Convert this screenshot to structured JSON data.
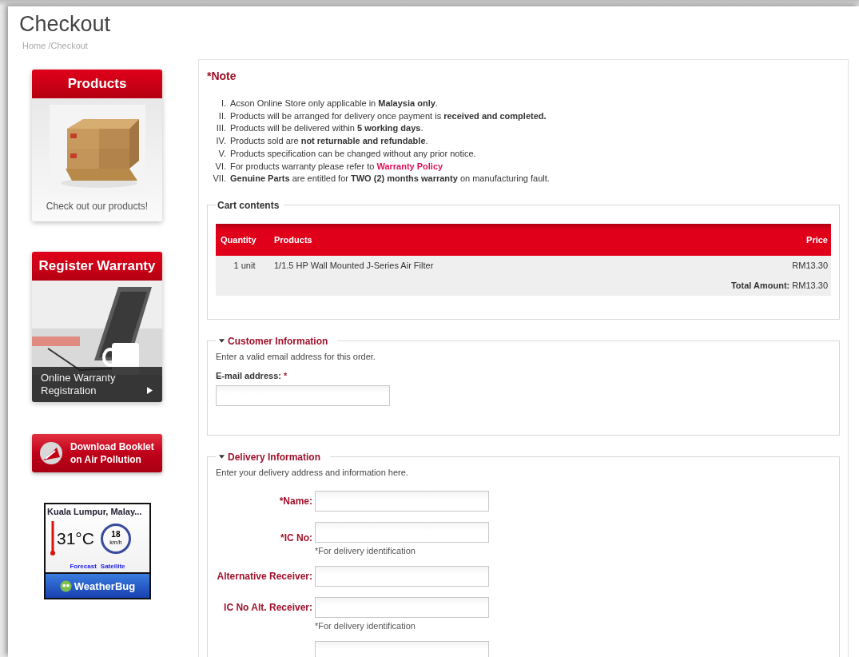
{
  "page": {
    "title": "Checkout",
    "breadcrumb": "Home /Checkout"
  },
  "sidebar": {
    "products_card": {
      "title": "Products",
      "caption": "Check out our products!"
    },
    "warranty_card": {
      "title": "Register Warranty",
      "caption_line1": "Online Warranty",
      "caption_line2": "Registration"
    },
    "booklet_button": {
      "line1": "Download Booklet",
      "line2": "on Air Pollution"
    },
    "weather": {
      "location": "Kuala Lumpur, Malay...",
      "temperature": "31°C",
      "wind_speed": "18",
      "wind_unit": "km/h",
      "links": [
        "Forecast",
        "Satellite"
      ],
      "brand": "WeatherBug"
    }
  },
  "note": {
    "title": "*Note",
    "items": [
      {
        "numeral": "I.",
        "text": "Acson Online Store only applicable in **Malaysia only**."
      },
      {
        "numeral": "II.",
        "text": "Products will be arranged for delivery once payment is **received and completed.**"
      },
      {
        "numeral": "III.",
        "text": "Products will be delivered within **5 working days**."
      },
      {
        "numeral": "IV.",
        "text": "Products sold are **not returnable and refundable**."
      },
      {
        "numeral": "V.",
        "text": "Products specification can be changed without any prior notice."
      },
      {
        "numeral": "VI.",
        "text": "For products warranty please refer to ",
        "link": "Warranty Policy"
      },
      {
        "numeral": "VII.",
        "text": "**Genuine Parts** are entitled for **TWO (2) months warranty** on manufacturing fault."
      }
    ]
  },
  "cart": {
    "legend": "Cart contents",
    "columns": [
      "Quantity",
      "Products",
      "Price"
    ],
    "rows": [
      {
        "quantity": "1 unit",
        "product": "1/1.5 HP Wall Mounted J-Series Air Filter",
        "price": "RM13.30"
      }
    ],
    "total_label": "Total Amount:",
    "total_value": "RM13.30"
  },
  "customer": {
    "legend": "Customer Information",
    "expanded": true,
    "intro": "Enter a valid email address for this order.",
    "email_label": "E-mail address:",
    "required_mark": "*"
  },
  "delivery": {
    "legend": "Delivery Information",
    "expanded": true,
    "intro": "Enter your delivery address and information here.",
    "fields": [
      {
        "label": "*Name:"
      },
      {
        "label": "*IC No:",
        "hint": "*For delivery identification"
      },
      {
        "label": "Alternative Receiver:"
      },
      {
        "label": "IC No Alt. Receiver:",
        "hint": "*For delivery identification"
      }
    ]
  }
}
